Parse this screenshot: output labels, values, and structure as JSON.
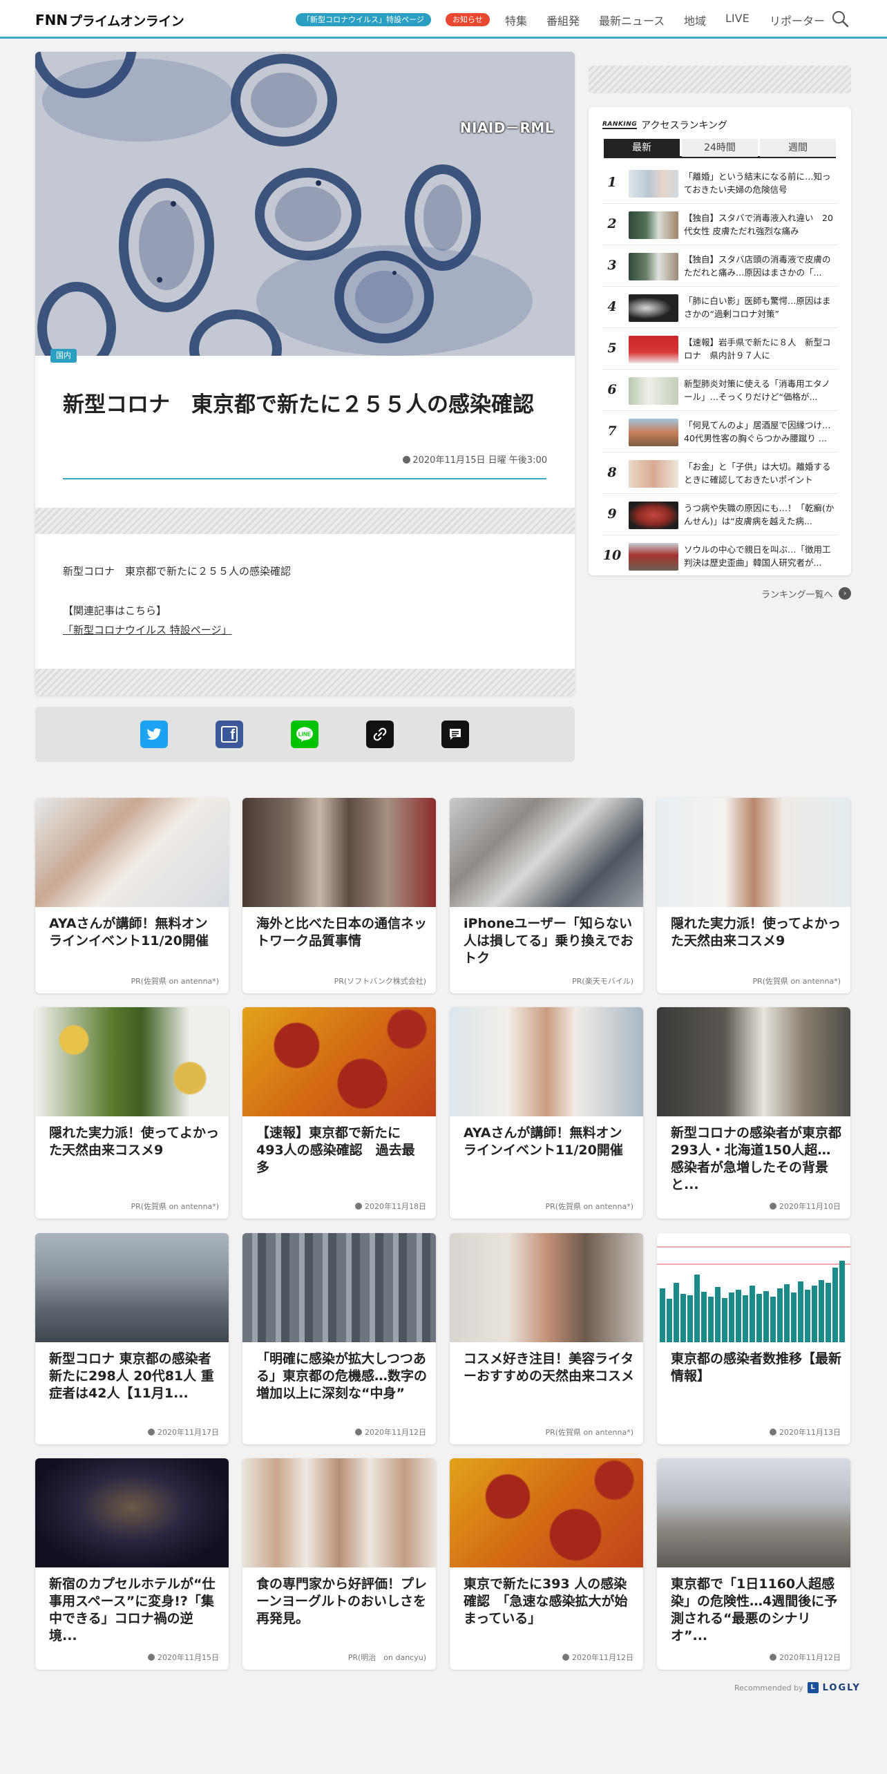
{
  "header": {
    "logo_prefix": "FNN",
    "logo_text": "プライムオンライン",
    "corona_pill": "「新型コロナウイルス」特設ページ",
    "notice_pill": "お知らせ",
    "nav": [
      "特集",
      "番組発",
      "最新ニュース",
      "地域",
      "LIVE",
      "リポーター"
    ]
  },
  "article": {
    "image_credit": "NIAID－RML",
    "category": "国内",
    "title": "新型コロナ　東京都で新たに２５５人の感染確認",
    "date": "2020年11月15日 日曜 午後3:00",
    "body": "新型コロナ　東京都で新たに２５５人の感染確認",
    "related_label": "【関連記事はこちら】",
    "related_link": "「新型コロナウイルス 特設ページ」"
  },
  "share": {
    "icons": [
      "twitter-icon",
      "facebook-icon",
      "line-icon",
      "link-icon",
      "comment-icon"
    ]
  },
  "ranking": {
    "label": "RANKING",
    "title": "アクセスランキング",
    "tabs": [
      "最新",
      "24時間",
      "週間"
    ],
    "active_tab": "最新",
    "items": [
      {
        "num": "1",
        "text": "「離婚」という結末になる前に…知っておきたい夫婦の危険信号"
      },
      {
        "num": "2",
        "text": "【独自】スタバで消毒液入れ違い　20代女性 皮膚ただれ強烈な痛み"
      },
      {
        "num": "3",
        "text": "【独自】スタバ店頭の消毒液で皮膚のただれと痛み…原因はまさかの「..."
      },
      {
        "num": "4",
        "text": "「肺に白い影」医師も驚愕…原因はまさかの“過剰コロナ対策”"
      },
      {
        "num": "5",
        "text": "【速報】岩手県で新たに８人　新型コロナ　県内計９７人に"
      },
      {
        "num": "6",
        "text": "新型肺炎対策に使える「消毒用エタノール」…そっくりだけど“価格が..."
      },
      {
        "num": "7",
        "text": "「何見てんのよ」居酒屋で因縁つけ…40代男性客の胸ぐらつかみ腰蹴り ..."
      },
      {
        "num": "8",
        "text": "「お金」と「子供」は大切。離婚するときに確認しておきたいポイント"
      },
      {
        "num": "9",
        "text": "うつ病や失職の原因にも…！「乾癬(かんせん)」は“皮膚病を越えた病..."
      },
      {
        "num": "10",
        "text": "ソウルの中心で親日を叫ぶ…「徴用工判決は歴史歪曲」韓国人研究者が..."
      }
    ],
    "more": "ランキング一覧へ"
  },
  "cards": [
    {
      "title": "AYAさんが講師！無料オンラインイベント11/20開催",
      "meta": "PR(佐賀県 on antenna*)",
      "dated": false
    },
    {
      "title": "海外と比べた日本の通信ネットワーク品質事情",
      "meta": "PR(ソフトバンク株式会社)",
      "dated": false
    },
    {
      "title": "iPhoneユーザー「知らない人は損してる」乗り換えでおトク",
      "meta": "PR(楽天モバイル)",
      "dated": false
    },
    {
      "title": "隠れた実力派！使ってよかった天然由来コスメ9",
      "meta": "PR(佐賀県 on antenna*)",
      "dated": false
    },
    {
      "title": "隠れた実力派！使ってよかった天然由来コスメ9",
      "meta": "PR(佐賀県 on antenna*)",
      "dated": false
    },
    {
      "title": "【速報】東京都で新たに493人の感染確認　過去最多",
      "meta": "2020年11月18日",
      "dated": true
    },
    {
      "title": "AYAさんが講師！無料オンラインイベント11/20開催",
      "meta": "PR(佐賀県 on antenna*)",
      "dated": false
    },
    {
      "title": "新型コロナの感染者が東京都293人・北海道150人超…感染者が急増したその背景と...",
      "meta": "2020年11月10日",
      "dated": true
    },
    {
      "title": "新型コロナ 東京都の感染者新たに298人 20代81人 重症者は42人【11月1...",
      "meta": "2020年11月17日",
      "dated": true
    },
    {
      "title": "「明確に感染が拡大しつつある」東京都の危機感…数字の増加以上に深刻な“中身”",
      "meta": "2020年11月12日",
      "dated": true
    },
    {
      "title": "コスメ好き注目！美容ライターおすすめの天然由来コスメ",
      "meta": "PR(佐賀県 on antenna*)",
      "dated": false
    },
    {
      "title": "東京都の感染者数推移【最新情報】",
      "meta": "2020年11月13日",
      "dated": true
    },
    {
      "title": "新宿のカプセルホテルが“仕事用スペース”に変身!?「集中できる」コロナ禍の逆境...",
      "meta": "2020年11月15日",
      "dated": true
    },
    {
      "title": "食の専門家から好評価！プレーンヨーグルトのおいしさを再発見。",
      "meta": "PR(明治　on dancyu)",
      "dated": false
    },
    {
      "title": "東京で新たに393 人の感染確認　「急速な感染拡大が始まっている」",
      "meta": "2020年11月12日",
      "dated": true
    },
    {
      "title": "東京都で「1日1160人超感染」の危険性…4週間後に予測される“最悪のシナリオ”...",
      "meta": "2020年11月12日",
      "dated": true
    }
  ],
  "footer": {
    "recommended": "Recommended by",
    "logly": "LOGLY"
  }
}
